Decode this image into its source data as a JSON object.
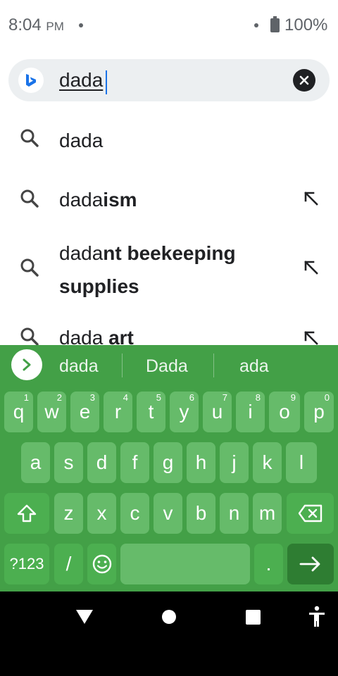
{
  "status_bar": {
    "time": "8:04",
    "ampm": "PM",
    "battery": "100%"
  },
  "search": {
    "query": "dada",
    "logo_icon": "bing-logo-icon",
    "clear_icon": "close-circle-icon"
  },
  "suggestions": [
    {
      "prefix": "dada",
      "suffix": "",
      "has_arrow": false
    },
    {
      "prefix": "dada",
      "suffix": "ism",
      "has_arrow": true
    },
    {
      "prefix": "dada",
      "suffix": "nt beekeeping",
      "suffix2": "supplies",
      "has_arrow": true
    },
    {
      "prefix": "dada",
      "suffix": " art",
      "has_arrow": true
    }
  ],
  "keyboard": {
    "strip": [
      "dada",
      "Dada",
      "ada"
    ],
    "row1": [
      {
        "k": "q",
        "h": "1"
      },
      {
        "k": "w",
        "h": "2"
      },
      {
        "k": "e",
        "h": "3"
      },
      {
        "k": "r",
        "h": "4"
      },
      {
        "k": "t",
        "h": "5"
      },
      {
        "k": "y",
        "h": "6"
      },
      {
        "k": "u",
        "h": "7"
      },
      {
        "k": "i",
        "h": "8"
      },
      {
        "k": "o",
        "h": "9"
      },
      {
        "k": "p",
        "h": "0"
      }
    ],
    "row2": [
      "a",
      "s",
      "d",
      "f",
      "g",
      "h",
      "j",
      "k",
      "l"
    ],
    "row3": [
      "z",
      "x",
      "c",
      "v",
      "b",
      "n",
      "m"
    ],
    "symbols_label": "?123",
    "slash_label": "/",
    "period_label": ".",
    "colors": {
      "background": "#43a047",
      "key": "#66bb6a",
      "enter": "#2e7d32"
    }
  }
}
